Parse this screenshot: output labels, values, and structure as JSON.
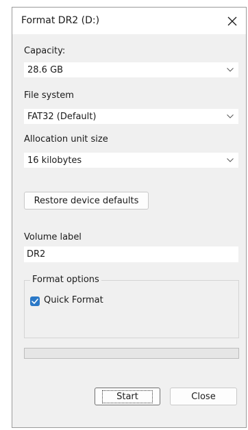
{
  "window": {
    "title": "Format DR2 (D:)"
  },
  "capacity": {
    "label": "Capacity:",
    "value": "28.6 GB"
  },
  "file_system": {
    "label": "File system",
    "value": "FAT32 (Default)"
  },
  "allocation": {
    "label": "Allocation unit size",
    "value": "16 kilobytes"
  },
  "restore_button": {
    "label": "Restore device defaults"
  },
  "volume": {
    "label": "Volume label",
    "value": "DR2"
  },
  "format_options": {
    "title": "Format options",
    "quick_format_label": "Quick Format",
    "quick_format_checked": true
  },
  "progress": {
    "value": 0
  },
  "buttons": {
    "start": "Start",
    "close": "Close"
  },
  "icons": {
    "close": "close-icon",
    "dropdown": "chevron-down-icon",
    "check": "checkmark-icon"
  },
  "colors": {
    "accent": "#2a78c7",
    "dialog_bg": "#f0f0f0",
    "progress_fill": "#06b025"
  }
}
